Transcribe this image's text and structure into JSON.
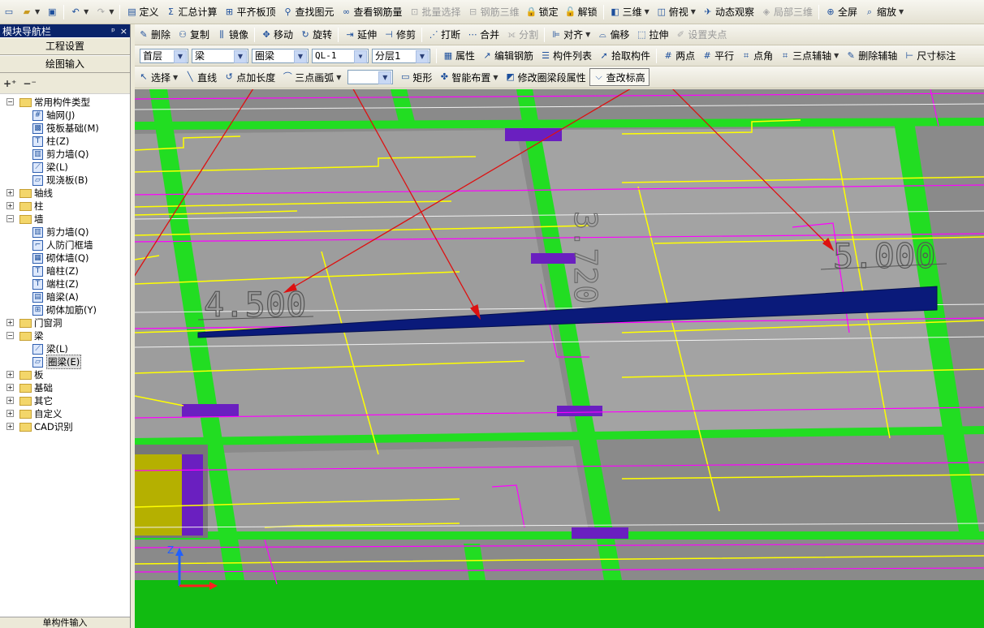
{
  "menubar1": {
    "items": [
      {
        "label": "定义",
        "icon": "define-icon",
        "enabled": true
      },
      {
        "label": "汇总计算",
        "icon": "sigma-icon",
        "enabled": true
      },
      {
        "label": "平齐板顶",
        "icon": "align-slab-icon",
        "enabled": true
      },
      {
        "label": "查找图元",
        "icon": "binoculars-icon",
        "enabled": true
      },
      {
        "label": "查看钢筋量",
        "icon": "view-rebar-icon",
        "enabled": true
      },
      {
        "label": "批量选择",
        "icon": "batch-select-icon",
        "enabled": false
      },
      {
        "label": "钢筋三维",
        "icon": "rebar-3d-icon",
        "enabled": false
      },
      {
        "label": "锁定",
        "icon": "lock-icon",
        "enabled": true
      },
      {
        "label": "解锁",
        "icon": "unlock-icon",
        "enabled": true
      },
      {
        "label": "三维",
        "icon": "cube-3d-icon",
        "enabled": true
      },
      {
        "label": "俯视",
        "icon": "top-view-icon",
        "enabled": true
      },
      {
        "label": "动态观察",
        "icon": "orbit-icon",
        "enabled": true
      },
      {
        "label": "局部三维",
        "icon": "local-3d-icon",
        "enabled": false
      },
      {
        "label": "全屏",
        "icon": "fullscreen-icon",
        "enabled": true
      },
      {
        "label": "缩放",
        "icon": "zoom-icon",
        "enabled": true
      }
    ]
  },
  "toolbar2": {
    "items": [
      {
        "label": "删除",
        "icon": "delete-icon",
        "enabled": true
      },
      {
        "label": "复制",
        "icon": "copy-icon",
        "enabled": true
      },
      {
        "label": "镜像",
        "icon": "mirror-icon",
        "enabled": true
      },
      {
        "label": "移动",
        "icon": "move-icon",
        "enabled": true
      },
      {
        "label": "旋转",
        "icon": "rotate-icon",
        "enabled": true
      },
      {
        "label": "延伸",
        "icon": "extend-icon",
        "enabled": true
      },
      {
        "label": "修剪",
        "icon": "trim-icon",
        "enabled": true
      },
      {
        "label": "打断",
        "icon": "break-icon",
        "enabled": true
      },
      {
        "label": "合并",
        "icon": "merge-icon",
        "enabled": true
      },
      {
        "label": "分割",
        "icon": "split-icon",
        "enabled": false
      },
      {
        "label": "对齐",
        "icon": "align-icon",
        "enabled": true
      },
      {
        "label": "偏移",
        "icon": "offset-icon",
        "enabled": true
      },
      {
        "label": "拉伸",
        "icon": "stretch-icon",
        "enabled": true
      },
      {
        "label": "设置夹点",
        "icon": "grip-icon",
        "enabled": false
      }
    ]
  },
  "toolbar3": {
    "floor": "首层",
    "category": "梁",
    "type": "圈梁",
    "component": "QL-1",
    "layer": "分层1",
    "items": [
      {
        "label": "属性",
        "icon": "property-icon"
      },
      {
        "label": "编辑钢筋",
        "icon": "edit-rebar-icon"
      },
      {
        "label": "构件列表",
        "icon": "component-list-icon"
      },
      {
        "label": "拾取构件",
        "icon": "pick-icon"
      },
      {
        "label": "两点",
        "icon": "two-point-icon"
      },
      {
        "label": "平行",
        "icon": "parallel-icon"
      },
      {
        "label": "点角",
        "icon": "point-angle-icon"
      },
      {
        "label": "三点辅轴",
        "icon": "three-point-axis-icon"
      },
      {
        "label": "删除辅轴",
        "icon": "delete-axis-icon"
      },
      {
        "label": "尺寸标注",
        "icon": "dimension-icon"
      }
    ]
  },
  "toolbar4": {
    "items": [
      {
        "label": "选择",
        "icon": "cursor-icon"
      },
      {
        "label": "直线",
        "icon": "line-icon"
      },
      {
        "label": "点加长度",
        "icon": "point-length-icon"
      },
      {
        "label": "三点画弧",
        "icon": "arc-icon"
      },
      {
        "label": "",
        "icon": "blank-select-icon"
      },
      {
        "label": "矩形",
        "icon": "rectangle-icon"
      },
      {
        "label": "智能布置",
        "icon": "smart-layout-icon"
      },
      {
        "label": "修改圈梁段属性",
        "icon": "modify-segment-icon"
      },
      {
        "label": "查改标高",
        "icon": "elevation-icon"
      }
    ]
  },
  "nav": {
    "title": "模块导航栏",
    "pin": "ᵖ",
    "close": "×",
    "project_settings": "工程设置",
    "drawing_input": "绘图输入",
    "bottom": "单构件输入",
    "tree": [
      {
        "label": "常用构件类型",
        "level": 0,
        "type": "folder",
        "expanded": true,
        "icon": "folder-icon"
      },
      {
        "label": "轴网(J)",
        "level": 1,
        "icon": "grid-icon"
      },
      {
        "label": "筏板基础(M)",
        "level": 1,
        "icon": "raft-icon"
      },
      {
        "label": "柱(Z)",
        "level": 1,
        "icon": "column-icon"
      },
      {
        "label": "剪力墙(Q)",
        "level": 1,
        "icon": "shear-wall-icon"
      },
      {
        "label": "梁(L)",
        "level": 1,
        "icon": "beam-icon"
      },
      {
        "label": "现浇板(B)",
        "level": 1,
        "icon": "slab-icon"
      },
      {
        "label": "轴线",
        "level": 0,
        "type": "folder",
        "expanded": false,
        "icon": "folder-icon"
      },
      {
        "label": "柱",
        "level": 0,
        "type": "folder",
        "expanded": false,
        "icon": "folder-icon"
      },
      {
        "label": "墙",
        "level": 0,
        "type": "folder",
        "expanded": true,
        "icon": "folder-icon"
      },
      {
        "label": "剪力墙(Q)",
        "level": 1,
        "icon": "shear-wall-icon"
      },
      {
        "label": "人防门框墙",
        "level": 1,
        "icon": "door-frame-wall-icon"
      },
      {
        "label": "砌体墙(Q)",
        "level": 1,
        "icon": "masonry-wall-icon"
      },
      {
        "label": "暗柱(Z)",
        "level": 1,
        "icon": "hidden-column-icon"
      },
      {
        "label": "端柱(Z)",
        "level": 1,
        "icon": "end-column-icon"
      },
      {
        "label": "暗梁(A)",
        "level": 1,
        "icon": "hidden-beam-icon"
      },
      {
        "label": "砌体加筋(Y)",
        "level": 1,
        "icon": "masonry-rebar-icon"
      },
      {
        "label": "门窗洞",
        "level": 0,
        "type": "folder",
        "expanded": false,
        "icon": "folder-icon"
      },
      {
        "label": "梁",
        "level": 0,
        "type": "folder",
        "expanded": true,
        "icon": "folder-icon"
      },
      {
        "label": "梁(L)",
        "level": 1,
        "icon": "beam-icon"
      },
      {
        "label": "圈梁(E)",
        "level": 1,
        "icon": "ring-beam-icon",
        "selected": true
      },
      {
        "label": "板",
        "level": 0,
        "type": "folder",
        "expanded": false,
        "icon": "folder-icon"
      },
      {
        "label": "基础",
        "level": 0,
        "type": "folder",
        "expanded": false,
        "icon": "folder-icon"
      },
      {
        "label": "其它",
        "level": 0,
        "type": "folder",
        "expanded": false,
        "icon": "folder-icon"
      },
      {
        "label": "自定义",
        "level": 0,
        "type": "folder",
        "expanded": false,
        "icon": "folder-icon"
      },
      {
        "label": "CAD识别",
        "level": 0,
        "type": "folder",
        "expanded": false,
        "icon": "folder-icon"
      }
    ]
  },
  "canvas": {
    "elevation_left": "4.500",
    "elevation_right": "5.000",
    "vertical_text": "3.720",
    "axis_z": "Z",
    "colors": {
      "background": "#808080",
      "column": "#22dd22",
      "beam_selected": "#0a1a7a",
      "rebar": "#ffff00",
      "axis": "#ff00ff",
      "annotation": "#cc0000",
      "purple": "#6a1fc0"
    }
  }
}
